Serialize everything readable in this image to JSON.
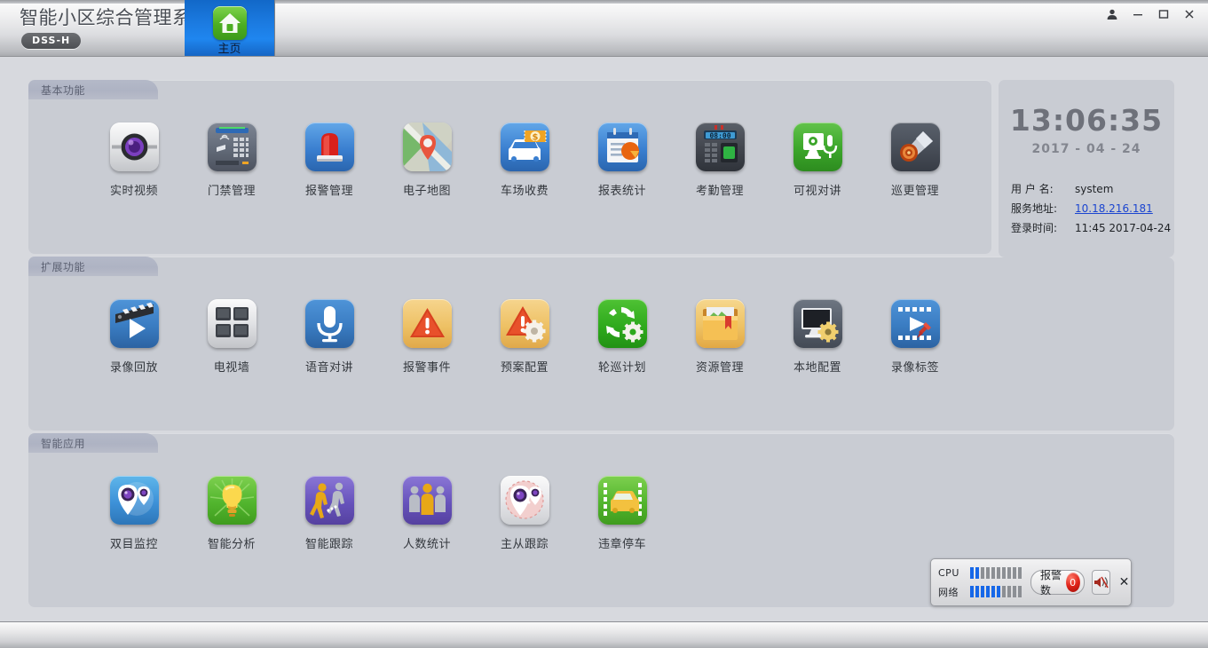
{
  "window": {
    "title": "智能小区综合管理系统",
    "badge": "DSS-H",
    "controls": {
      "user": "user-icon",
      "minimize": "−",
      "maximize": "□",
      "close": "✕"
    }
  },
  "tab": {
    "label": "主页",
    "icon": "home-icon",
    "active": true
  },
  "sections": [
    {
      "title": "基本功能",
      "items": [
        {
          "label": "实时视频",
          "icon": "camera-icon"
        },
        {
          "label": "门禁管理",
          "icon": "access-keypad-icon"
        },
        {
          "label": "报警管理",
          "icon": "alarm-siren-icon"
        },
        {
          "label": "电子地图",
          "icon": "map-pin-icon"
        },
        {
          "label": "车场收费",
          "icon": "car-payment-icon"
        },
        {
          "label": "报表统计",
          "icon": "report-chart-icon"
        },
        {
          "label": "考勤管理",
          "icon": "attendance-clock-icon"
        },
        {
          "label": "可视对讲",
          "icon": "video-intercom-icon"
        },
        {
          "label": "巡更管理",
          "icon": "patrol-baton-icon"
        }
      ]
    },
    {
      "title": "扩展功能",
      "items": [
        {
          "label": "录像回放",
          "icon": "playback-clapper-icon"
        },
        {
          "label": "电视墙",
          "icon": "tv-wall-icon"
        },
        {
          "label": "语音对讲",
          "icon": "microphone-icon"
        },
        {
          "label": "报警事件",
          "icon": "warning-triangle-icon"
        },
        {
          "label": "预案配置",
          "icon": "warning-gear-icon"
        },
        {
          "label": "轮巡计划",
          "icon": "refresh-gear-icon"
        },
        {
          "label": "资源管理",
          "icon": "folder-icon"
        },
        {
          "label": "本地配置",
          "icon": "monitor-gear-icon"
        },
        {
          "label": "录像标签",
          "icon": "film-pin-icon"
        }
      ]
    },
    {
      "title": "智能应用",
      "items": [
        {
          "label": "双目监控",
          "icon": "dual-lens-icon"
        },
        {
          "label": "智能分析",
          "icon": "lightbulb-icon"
        },
        {
          "label": "智能跟踪",
          "icon": "people-track-icon"
        },
        {
          "label": "人数统计",
          "icon": "people-count-icon"
        },
        {
          "label": "主从跟踪",
          "icon": "master-slave-icon"
        },
        {
          "label": "违章停车",
          "icon": "illegal-parking-icon"
        }
      ]
    }
  ],
  "info": {
    "time": "13:06:35",
    "date": "2017 - 04 - 24",
    "rows": [
      {
        "key": "用 户 名:",
        "value": "system",
        "link": false
      },
      {
        "key": "服务地址:",
        "value": "10.18.216.181",
        "link": true
      },
      {
        "key": "登录时间:",
        "value": "11:45 2017-04-24",
        "link": false
      }
    ]
  },
  "status": {
    "cpu_label": "CPU",
    "net_label": "网络",
    "cpu_bars": 2,
    "net_bars": 6,
    "bar_total": 10,
    "alarm_label": "报警数",
    "alarm_count": "0",
    "sound_icon": "speaker-mute-icon",
    "close_icon": "✕"
  },
  "colors": {
    "accent_blue": "#1667e8",
    "tab_blue": "#1f86ef",
    "link": "#1b45d0",
    "panel": "#c9ccd3",
    "background": "#d7d9de"
  }
}
